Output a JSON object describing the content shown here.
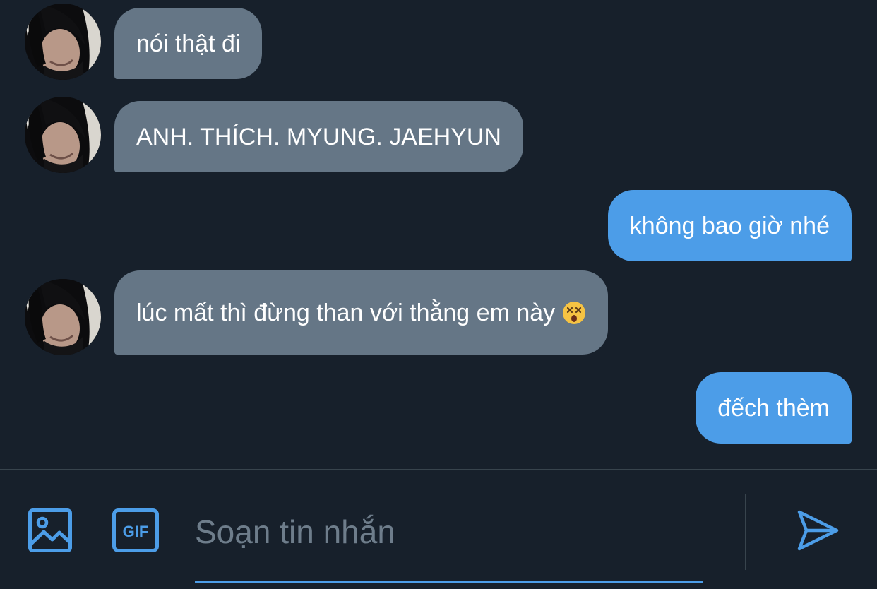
{
  "messages": [
    {
      "from": "other",
      "text": "nói thật đi"
    },
    {
      "from": "other",
      "text": "ANH. THÍCH. MYUNG. JAEHYUN"
    },
    {
      "from": "me",
      "text": "không bao giờ nhé"
    },
    {
      "from": "other",
      "text": "lúc mất thì đừng than với thằng em này",
      "emoji": "dizzy-face-emoji"
    },
    {
      "from": "me",
      "text": "đếch thèm"
    }
  ],
  "composer": {
    "placeholder": "Soạn tin nhắn",
    "image_icon": "image-icon",
    "gif_icon": "gif-icon",
    "gif_label": "GIF",
    "send_icon": "send-icon"
  },
  "colors": {
    "background": "#17202b",
    "received_bubble": "#657686",
    "sent_bubble": "#4c9de8",
    "accent": "#4c9de8"
  }
}
